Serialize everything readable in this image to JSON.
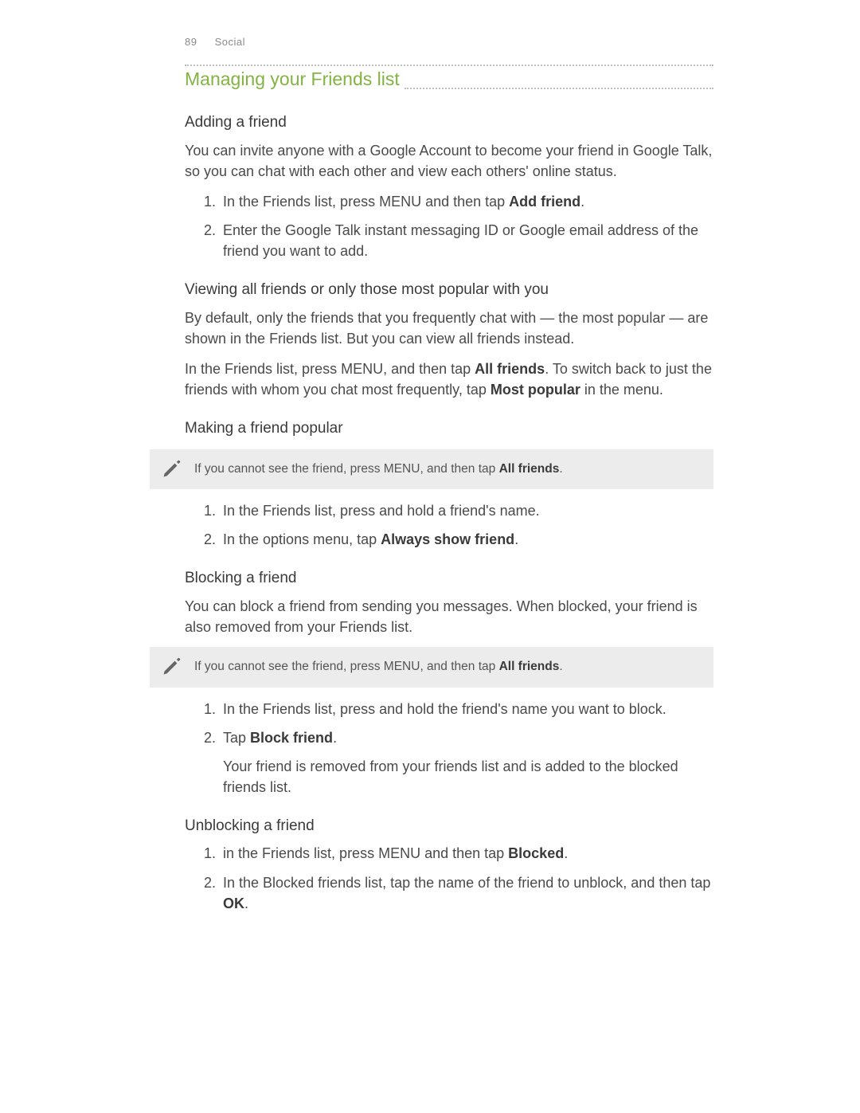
{
  "header": {
    "page_number": "89",
    "chapter": "Social"
  },
  "title": "Managing your Friends list",
  "adding": {
    "heading": "Adding a friend",
    "intro": "You can invite anyone with a Google Account to become your friend in Google Talk, so you can chat with each other and view each others' online status.",
    "step1_a": "In the Friends list, press MENU and then tap ",
    "step1_b": "Add friend",
    "step1_c": ".",
    "step2": "Enter the Google Talk instant messaging ID or Google email address of the friend you want to add."
  },
  "viewing": {
    "heading": "Viewing all friends or only those most popular with you",
    "p1": "By default, only the friends that you frequently chat with — the most popular — are shown in the Friends list. But you can view all friends instead.",
    "p2_a": "In the Friends list, press MENU, and then tap ",
    "p2_b": "All friends",
    "p2_c": ". To switch back to just the friends with whom you chat most frequently, tap ",
    "p2_d": "Most popular",
    "p2_e": " in the menu."
  },
  "making": {
    "heading": "Making a friend popular",
    "note_a": "If you cannot see the friend, press MENU, and then tap ",
    "note_b": "All friends",
    "note_c": ".",
    "step1": "In the Friends list, press and hold a friend's name.",
    "step2_a": "In the options menu, tap ",
    "step2_b": "Always show friend",
    "step2_c": "."
  },
  "blocking": {
    "heading": "Blocking a friend",
    "intro": "You can block a friend from sending you messages. When blocked, your friend is also removed from your Friends list.",
    "note_a": "If you cannot see the friend, press MENU, and then tap ",
    "note_b": "All friends",
    "note_c": ".",
    "step1": "In the Friends list, press and hold the friend's name you want to block.",
    "step2_a": "Tap ",
    "step2_b": "Block friend",
    "step2_c": ".",
    "step2_after": "Your friend is removed from your friends list and is added to the blocked friends list."
  },
  "unblocking": {
    "heading": "Unblocking a friend",
    "step1_a": "in the Friends list, press MENU and then tap ",
    "step1_b": "Blocked",
    "step1_c": ".",
    "step2_a": "In the Blocked friends list, tap the name of the friend to unblock, and then tap ",
    "step2_b": "OK",
    "step2_c": "."
  }
}
